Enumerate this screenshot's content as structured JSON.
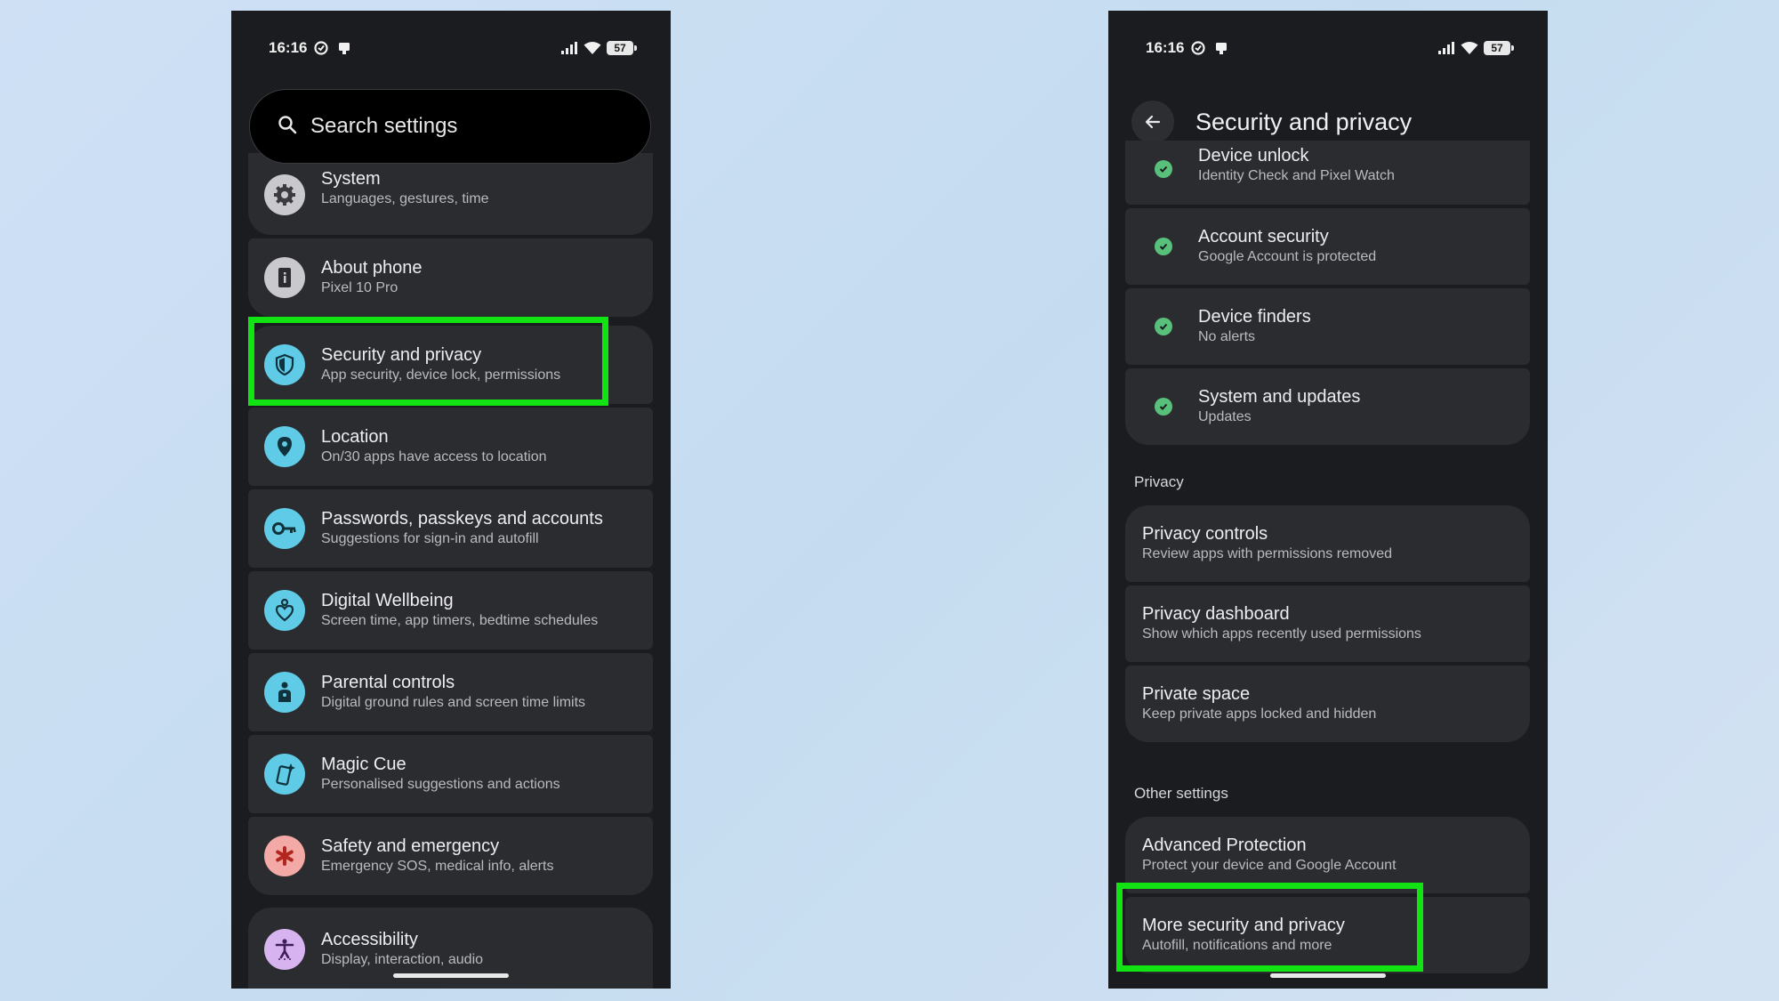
{
  "colors": {
    "background": "#c9ddf2",
    "phone_bg": "#1b1c1f",
    "card_bg": "#2b2c30",
    "highlight": "#12e312",
    "check_green": "#59c07c"
  },
  "status_bar": {
    "time": "16:16",
    "battery": "57"
  },
  "left_screen": {
    "search_placeholder": "Search settings",
    "items": [
      {
        "icon": "gear-icon",
        "title": "System",
        "subtitle": "Languages, gestures, time"
      },
      {
        "icon": "phone-info-icon",
        "title": "About phone",
        "subtitle": "Pixel 10 Pro"
      },
      {
        "icon": "shield-icon",
        "title": "Security and privacy",
        "subtitle": "App security, device lock, permissions"
      },
      {
        "icon": "location-pin-icon",
        "title": "Location",
        "subtitle": "On/30 apps have access to location"
      },
      {
        "icon": "key-icon",
        "title": "Passwords, passkeys and accounts",
        "subtitle": "Suggestions for sign-in and autofill"
      },
      {
        "icon": "wellbeing-heart-icon",
        "title": "Digital Wellbeing",
        "subtitle": "Screen time, app timers, bedtime schedules"
      },
      {
        "icon": "parental-controls-icon",
        "title": "Parental controls",
        "subtitle": "Digital ground rules and screen time limits"
      },
      {
        "icon": "magic-cue-icon",
        "title": "Magic Cue",
        "subtitle": "Personalised suggestions and actions"
      },
      {
        "icon": "asterisk-emergency-icon",
        "title": "Safety and emergency",
        "subtitle": "Emergency SOS, medical info, alerts"
      },
      {
        "icon": "accessibility-icon",
        "title": "Accessibility",
        "subtitle": "Display, interaction, audio"
      }
    ]
  },
  "right_screen": {
    "title": "Security and privacy",
    "status_items": [
      {
        "title": "Device unlock",
        "subtitle": "Identity Check and Pixel Watch"
      },
      {
        "title": "Account security",
        "subtitle": "Google Account is protected"
      },
      {
        "title": "Device finders",
        "subtitle": "No alerts"
      },
      {
        "title": "System and updates",
        "subtitle": "Updates"
      }
    ],
    "privacy_header": "Privacy",
    "privacy_items": [
      {
        "title": "Privacy controls",
        "subtitle": "Review apps with permissions removed"
      },
      {
        "title": "Privacy dashboard",
        "subtitle": "Show which apps recently used permissions"
      },
      {
        "title": "Private space",
        "subtitle": "Keep private apps locked and hidden"
      }
    ],
    "other_header": "Other settings",
    "other_items": [
      {
        "title": "Advanced Protection",
        "subtitle": "Protect your device and Google Account"
      },
      {
        "title": "More security and privacy",
        "subtitle": "Autofill, notifications and more"
      }
    ]
  }
}
